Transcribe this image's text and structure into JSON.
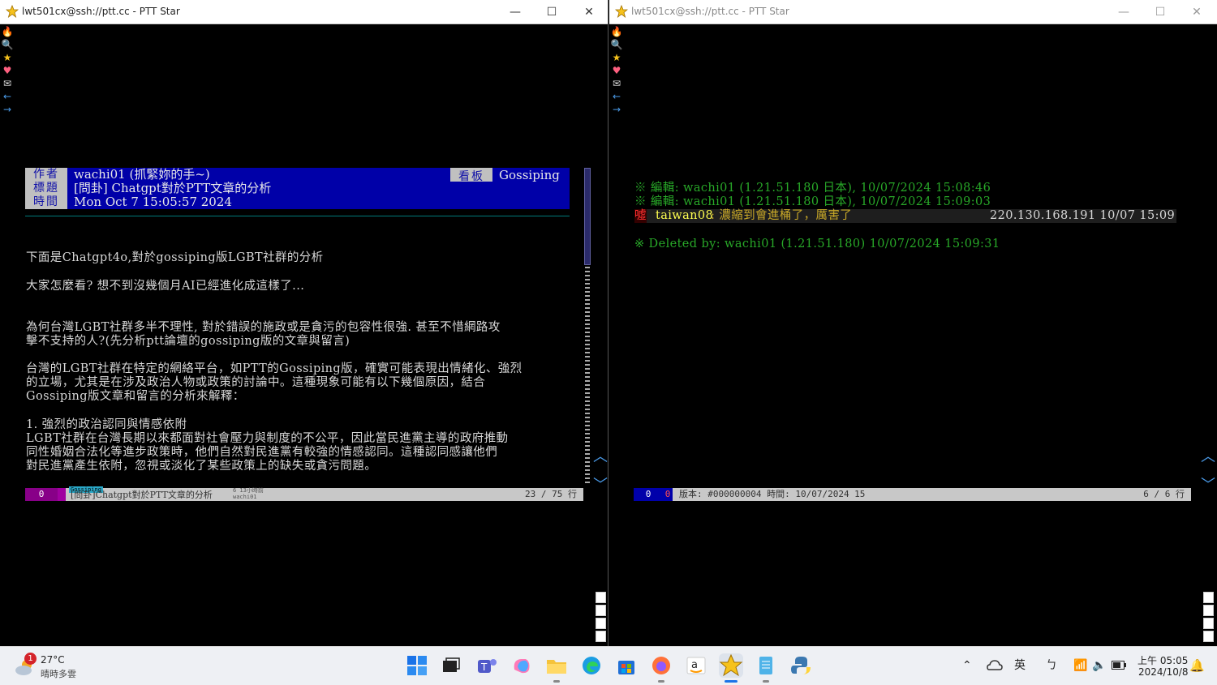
{
  "left_window": {
    "title": "lwt501cx@ssh://ptt.cc - PTT Star",
    "controls": {
      "minimize": "—",
      "maximize": "☐",
      "close": "✕"
    },
    "header": {
      "author_label": "作者",
      "author_value": "wachi01 (抓緊妳的手~)",
      "board_label": "看板",
      "board_value": "Gossiping",
      "title_label": "標題",
      "title_value": "[問卦] Chatgpt對於PTT文章的分析",
      "time_label": "時間",
      "time_value": "Mon Oct  7 15:05:57 2024"
    },
    "body_lines": [
      "下面是Chatgpt4o,對於gossiping版LGBT社群的分析",
      "大家怎麼看? 想不到沒幾個月AI已經進化成這樣了...",
      "為何台灣LGBT社群多半不理性, 對於錯誤的施政或是貪污的包容性很強. 甚至不惜網路攻",
      "擊不支持的人?(先分析ptt論壇的gossiping版的文章與留言)",
      "台灣的LGBT社群在特定的網絡平台，如PTT的Gossiping版，確實可能表現出情緒化、強烈",
      "的立場，尤其是在涉及政治人物或政策的討論中。這種現象可能有以下幾個原因，結合",
      "Gossiping版文章和留言的分析來解釋：",
      "1. 強烈的政治認同與情感依附",
      "LGBT社群在台灣長期以來都面對社會壓力與制度的不公平，因此當民進黨主導的政府推動",
      "同性婚姻合法化等進步政策時，他們自然對民進黨有較強的情感認同。這種認同感讓他們",
      "對民進黨產生依附，忽視或淡化了某些政策上的缺失或貪污問題。"
    ],
    "status": {
      "count": "0",
      "board_tag": "Gossiping",
      "article_title": "[問卦]Chatgpt對於PTT文章的分析",
      "age_tag": "6 13小時前",
      "author_tag": "wachi01",
      "position": "23 / 75 行"
    }
  },
  "right_window": {
    "title": "lwt501cx@ssh://ptt.cc - PTT Star",
    "controls": {
      "minimize": "—",
      "maximize": "☐",
      "close": "✕"
    },
    "edit_line_1": "※ 編輯: wachi01 (1.21.51.180 日本), 10/07/2024 15:08:46",
    "edit_line_2": "※ 編輯: wachi01 (1.21.51.180 日本), 10/07/2024 15:09:03",
    "push": {
      "tag": "噓",
      "user": "taiwan08",
      "content": ": 濃縮到會進桶了，厲害了",
      "ip_time": "220.130.168.191 10/07 15:09"
    },
    "deleted_line": "※ Deleted by: wachi01 (1.21.51.180) 10/07/2024 15:09:31",
    "status": {
      "count_a": "0",
      "count_b": "0",
      "version": "版本: #000000004  時間: 10/07/2024 15",
      "position": "6 / 6 行"
    }
  },
  "taskbar": {
    "weather_badge": "1",
    "weather_temp": "27°C",
    "weather_desc": "晴時多雲",
    "ime_lang": "英",
    "ime_mode": "ㄅ",
    "time": "上午 05:05",
    "date": "2024/10/8"
  },
  "colors": {
    "header_bg": "#0000a8",
    "header_label_bg": "#c0c0c0",
    "edit_green": "#28a828",
    "push_red": "#ff3030",
    "push_user_yellow": "#ffff50",
    "push_content_yellow": "#c8a828"
  }
}
